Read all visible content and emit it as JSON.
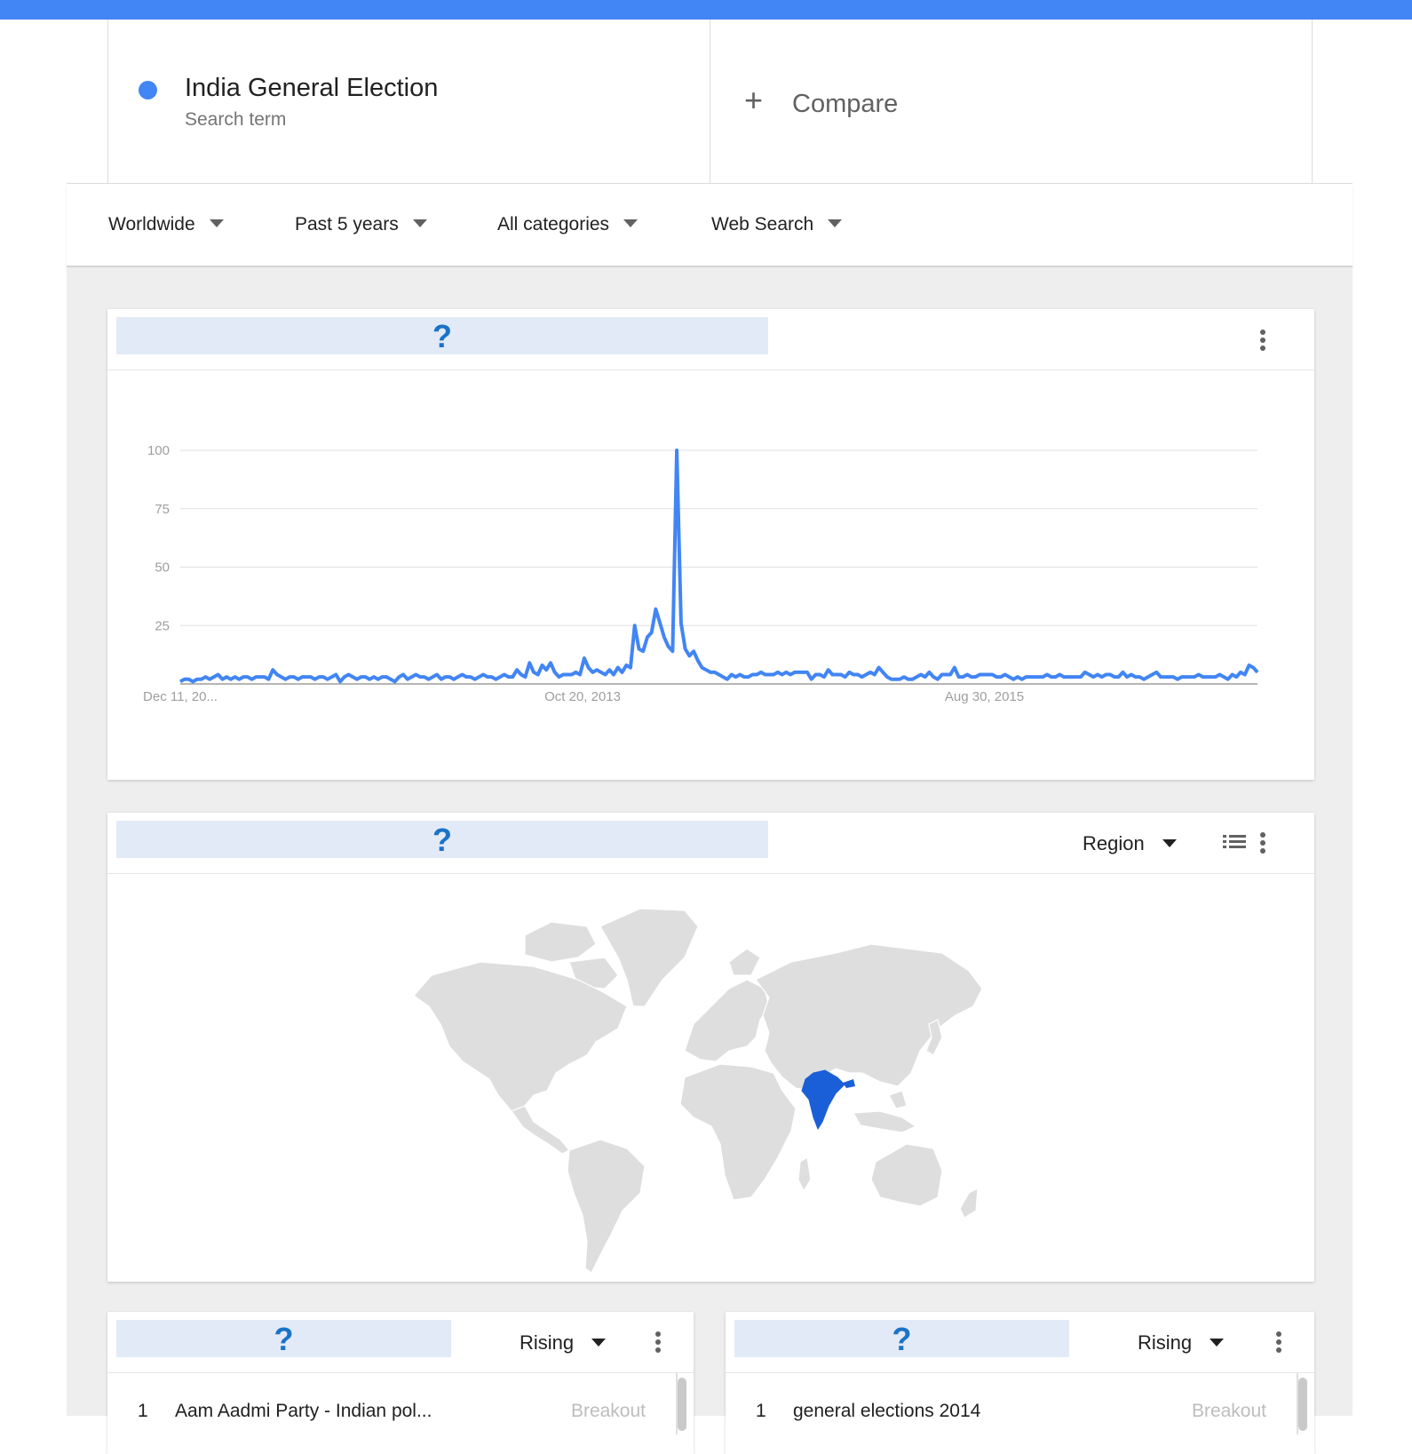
{
  "search_term": {
    "name": "India General Election",
    "sublabel": "Search term",
    "color": "#4285f4"
  },
  "compare": {
    "icon": "plus-icon",
    "label": "Compare"
  },
  "filters": [
    {
      "label": "Worldwide"
    },
    {
      "label": "Past 5 years"
    },
    {
      "label": "All categories"
    },
    {
      "label": "Web Search"
    }
  ],
  "interest_card": {
    "title_placeholder": "?",
    "menu_icon": "more-vert-icon"
  },
  "chart_data": {
    "type": "line",
    "y_ticks": [
      "100",
      "75",
      "50",
      "25"
    ],
    "x_ticks": [
      "Dec 11, 20...",
      "Oct 20, 2013",
      "Aug 30, 2015"
    ],
    "ylim": [
      0,
      100
    ],
    "grid": true,
    "line_color": "#4285f4",
    "series": [
      {
        "values": [
          1,
          2,
          2,
          1,
          2,
          2,
          3,
          2,
          3,
          4,
          2,
          3,
          2,
          3,
          2,
          3,
          3,
          2,
          3,
          3,
          3,
          2,
          6,
          4,
          3,
          2,
          3,
          3,
          2,
          3,
          3,
          3,
          2,
          3,
          3,
          2,
          3,
          4,
          1,
          3,
          4,
          3,
          2,
          3,
          3,
          2,
          3,
          2,
          3,
          3,
          2,
          1,
          3,
          4,
          2,
          3,
          4,
          3,
          3,
          2,
          3,
          4,
          2,
          3,
          3,
          2,
          3,
          4,
          3,
          3,
          2,
          3,
          4,
          3,
          3,
          2,
          3,
          4,
          3,
          3,
          6,
          4,
          3,
          9,
          5,
          4,
          8,
          6,
          9,
          5,
          3,
          4,
          4,
          4,
          5,
          4,
          11,
          7,
          5,
          6,
          5,
          4,
          6,
          4,
          7,
          5,
          8,
          7,
          25,
          15,
          14,
          20,
          22,
          32,
          26,
          20,
          16,
          14,
          100,
          26,
          15,
          12,
          14,
          10,
          7,
          6,
          5,
          5,
          4,
          3,
          2,
          4,
          3,
          4,
          3,
          3,
          4,
          4,
          5,
          4,
          4,
          4,
          5,
          4,
          5,
          4,
          5,
          5,
          5,
          5,
          2,
          4,
          4,
          3,
          6,
          4,
          4,
          4,
          3,
          5,
          4,
          4,
          3,
          4,
          5,
          4,
          7,
          5,
          3,
          2,
          2,
          2,
          3,
          2,
          2,
          3,
          4,
          3,
          5,
          3,
          2,
          4,
          4,
          4,
          7,
          3,
          3,
          4,
          3,
          3,
          4,
          4,
          4,
          4,
          3,
          3,
          4,
          3,
          2,
          3,
          2,
          3,
          3,
          3,
          3,
          3,
          4,
          3,
          3,
          4,
          3,
          3,
          3,
          3,
          3,
          5,
          4,
          3,
          4,
          3,
          4,
          4,
          3,
          3,
          5,
          3,
          4,
          3,
          3,
          2,
          3,
          4,
          5,
          3,
          3,
          3,
          3,
          2,
          3,
          3,
          3,
          3,
          4,
          3,
          3,
          3,
          3,
          4,
          3,
          2,
          4,
          3,
          5,
          4,
          8,
          7,
          5
        ]
      }
    ]
  },
  "region_card": {
    "title_placeholder": "?",
    "dropdown_label": "Region",
    "list_icon": "list-icon",
    "menu_icon": "more-vert-icon",
    "highlight_color": "#1a5fd8",
    "map_icon": "world-map"
  },
  "related_topics": {
    "title_placeholder": "?",
    "dropdown_label": "Rising",
    "rows": [
      {
        "rank": "1",
        "text": "Aam Aadmi Party - Indian pol...",
        "value": "Breakout"
      }
    ]
  },
  "related_queries": {
    "title_placeholder": "?",
    "dropdown_label": "Rising",
    "rows": [
      {
        "rank": "1",
        "text": "general elections 2014",
        "value": "Breakout"
      }
    ]
  }
}
